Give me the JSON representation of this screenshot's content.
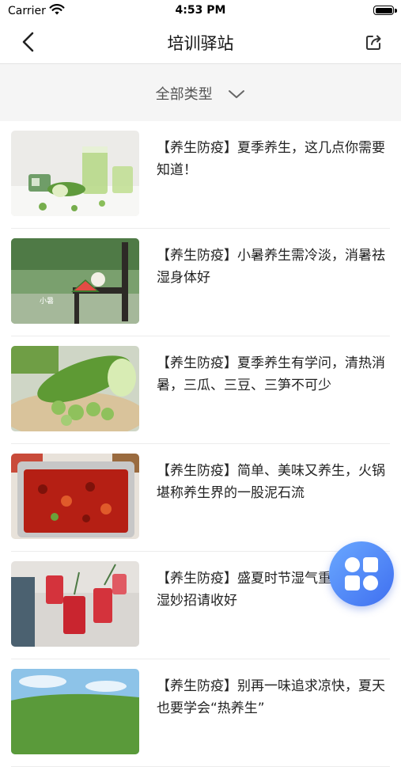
{
  "status_bar": {
    "carrier": "Carrier",
    "time": "4:53 PM"
  },
  "nav": {
    "title": "培训驿站"
  },
  "filter": {
    "label": "全部类型"
  },
  "articles": [
    {
      "title": "【养生防疫】夏季养生，这几点你需要知道！"
    },
    {
      "title": "【养生防疫】小暑养生需冷淡，消暑祛湿身体好"
    },
    {
      "title": "【养生防疫】夏季养生有学问，清热消暑，三瓜、三豆、三笋不可少"
    },
    {
      "title": "【养生防疫】简单、美味又养生，火锅堪称养生界的一股泥石流"
    },
    {
      "title": "【养生防疫】盛夏时节湿气重，夏天祛湿妙招请收好"
    },
    {
      "title": "【养生防疫】别再一味追求凉快，夏天也要学会“热养生”"
    }
  ],
  "thumb_caption": "小暑",
  "colors": {
    "fab_start": "#6aa8ff",
    "fab_end": "#3f6ff0",
    "background": "#f5f5f5"
  }
}
